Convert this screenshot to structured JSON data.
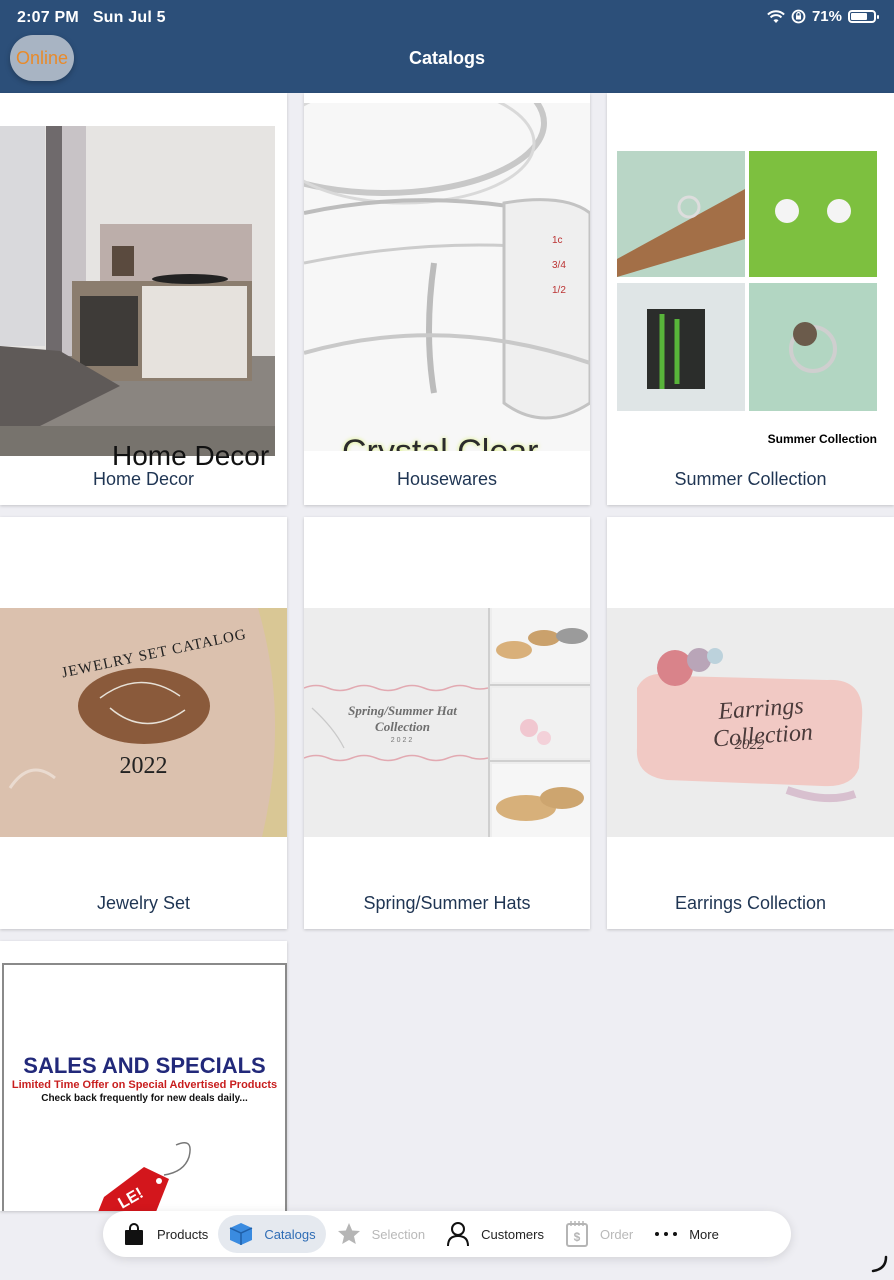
{
  "status_bar": {
    "time": "2:07 PM",
    "date": "Sun Jul 5",
    "battery": "71%",
    "battery_level": 0.71
  },
  "header": {
    "title": "Catalogs",
    "online_label": "Online"
  },
  "catalogs": [
    {
      "label": "Home Decor",
      "image_text": "Home Decor"
    },
    {
      "label": "Housewares",
      "image_text": "Crystal Clear"
    },
    {
      "label": "Summer Collection",
      "image_text": "Summer Collection"
    },
    {
      "label": "Jewelry Set",
      "image_text": "JEWELRY SET CATALOG",
      "image_year": "2022"
    },
    {
      "label": "Spring/Summer Hats",
      "image_text": "Spring/Summer Hat Collection",
      "image_year": "2022"
    },
    {
      "label": "Earrings Collection",
      "image_text": "Earrings Collection",
      "image_year": "2022"
    },
    {
      "label": "",
      "image_title": "SALES AND SPECIALS",
      "image_subtitle": "Limited Time Offer on Special Advertised Products",
      "image_note": "Check back frequently for new deals daily..."
    }
  ],
  "tabs": [
    {
      "label": "Products",
      "icon": "shopping-bag-icon",
      "state": "normal"
    },
    {
      "label": "Catalogs",
      "icon": "cube-icon",
      "state": "active"
    },
    {
      "label": "Selection",
      "icon": "star-icon",
      "state": "disabled"
    },
    {
      "label": "Customers",
      "icon": "person-icon",
      "state": "normal"
    },
    {
      "label": "Order",
      "icon": "invoice-icon",
      "state": "disabled"
    },
    {
      "label": "More",
      "icon": "ellipsis-icon",
      "state": "normal"
    }
  ],
  "colors": {
    "header": "#2c4f79",
    "online": "#e88a2a",
    "active_tab": "#2f6db5"
  }
}
